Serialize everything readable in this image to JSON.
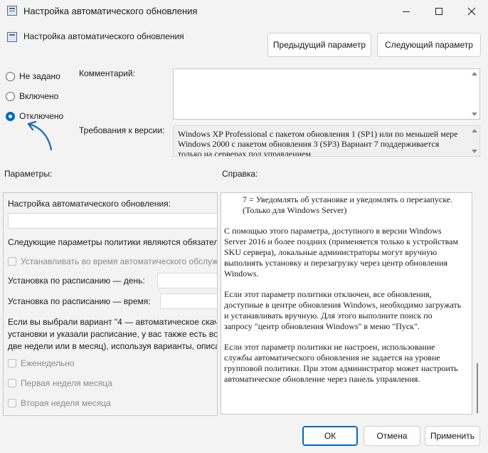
{
  "window": {
    "title": "Настройка автоматического обновления",
    "controls": {
      "minimize": "minimize-icon",
      "maximize": "maximize-icon",
      "close": "close-icon"
    }
  },
  "header": {
    "title": "Настройка автоматического обновления",
    "prev_button": "Предыдущий параметр",
    "next_button": "Следующий параметр"
  },
  "state": {
    "options": [
      {
        "label": "Не задано",
        "checked": false
      },
      {
        "label": "Включено",
        "checked": false
      },
      {
        "label": "Отключено",
        "checked": true
      }
    ]
  },
  "comment": {
    "label": "Комментарий:",
    "value": ""
  },
  "requirements": {
    "label": "Требования к версии:",
    "text": "Windows XP Professional с пакетом обновления 1 (SP1) или по меньшей мере Windows 2000 с пакетом обновления 3 (SP3) Вариант 7 поддерживается только на серверах под управлением"
  },
  "sections": {
    "params_label": "Параметры:",
    "help_label": "Справка:"
  },
  "params": {
    "title": "Настройка автоматического обновления:",
    "policy_note": "Следующие параметры политики являются обязател",
    "install_during_maintenance": "Устанавливать во время автоматического обслужи",
    "schedule_day_label": "Установка по расписанию — день:",
    "schedule_time_label": "Установка по расписанию — время:",
    "variant_note_line1": "Если вы выбрали вариант \"4 — автоматическое скач",
    "variant_note_line2": "установки и указали расписание, у вас также есть во",
    "variant_note_line3": "две недели или в месяц), используя варианты, описан",
    "weekly": "Еженедельно",
    "first_week": "Первая неделя месяца",
    "second_week": "Вторая неделя месяца"
  },
  "help": {
    "p1": "7 = Уведомлять об установке и уведомлять о перезапуске. (Только для Windows Server)",
    "p2": "С помощью этого параметра, доступного в версии Windows Server 2016 и более поздних (применяется только к устройствам SKU сервера), локальные администраторы могут вручную выполнять установку и перезагрузку через центр обновления Windows.",
    "p3": "Если этот параметр политики отключен, все обновления, доступные в центре обновления Windows, необходимо загружать и устанавливать вручную. Для этого выполните поиск по запросу \"центр обновления Windows\" в меню \"Пуск\".",
    "p4": "Если этот параметр политики не настроен, использование службы автоматического обновления не задается на уровне групповой политики. При этом администратор может настроить автоматическое обновление через панель управления."
  },
  "footer": {
    "ok": "ОК",
    "cancel": "Отмена",
    "apply": "Применить"
  },
  "colors": {
    "accent": "#0067c0",
    "annotation_arrow": "#2b6cb0"
  }
}
